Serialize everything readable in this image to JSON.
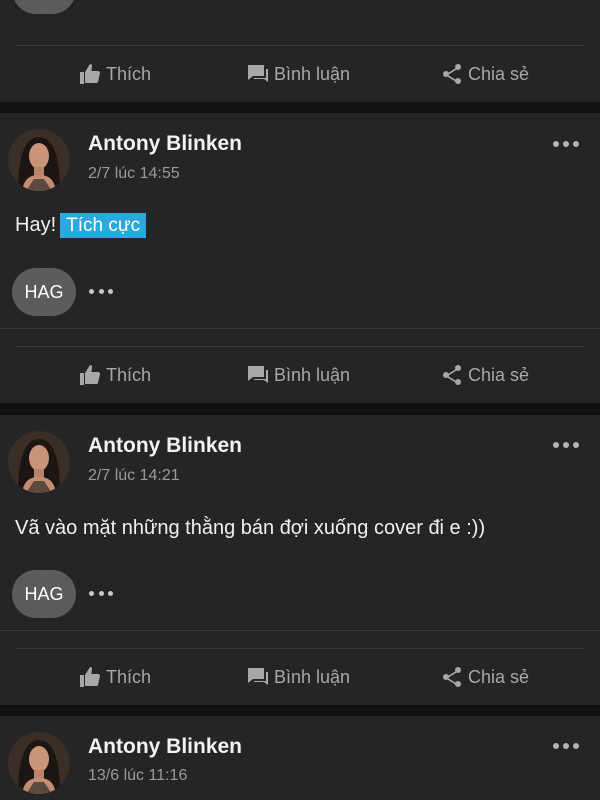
{
  "actions": {
    "like": "Thích",
    "comment": "Bình luận",
    "share": "Chia sẻ"
  },
  "posts": [
    {
      "author": "Antony Blinken",
      "time": "2/7 lúc 14:55",
      "text": "Hay!",
      "tag": "Tích cực",
      "reaction_badge": "HAG"
    },
    {
      "author": "Antony Blinken",
      "time": "2/7 lúc 14:21",
      "text": "Vã vào mặt những thằng bán đợi xuống cover đi e :))",
      "reaction_badge": "HAG"
    },
    {
      "author": "Antony Blinken",
      "time": "13/6 lúc 11:16"
    }
  ],
  "colors": {
    "background": "#111111",
    "card": "#252525",
    "tag": "#2aa9df",
    "muted_text": "#a8a8a8"
  }
}
